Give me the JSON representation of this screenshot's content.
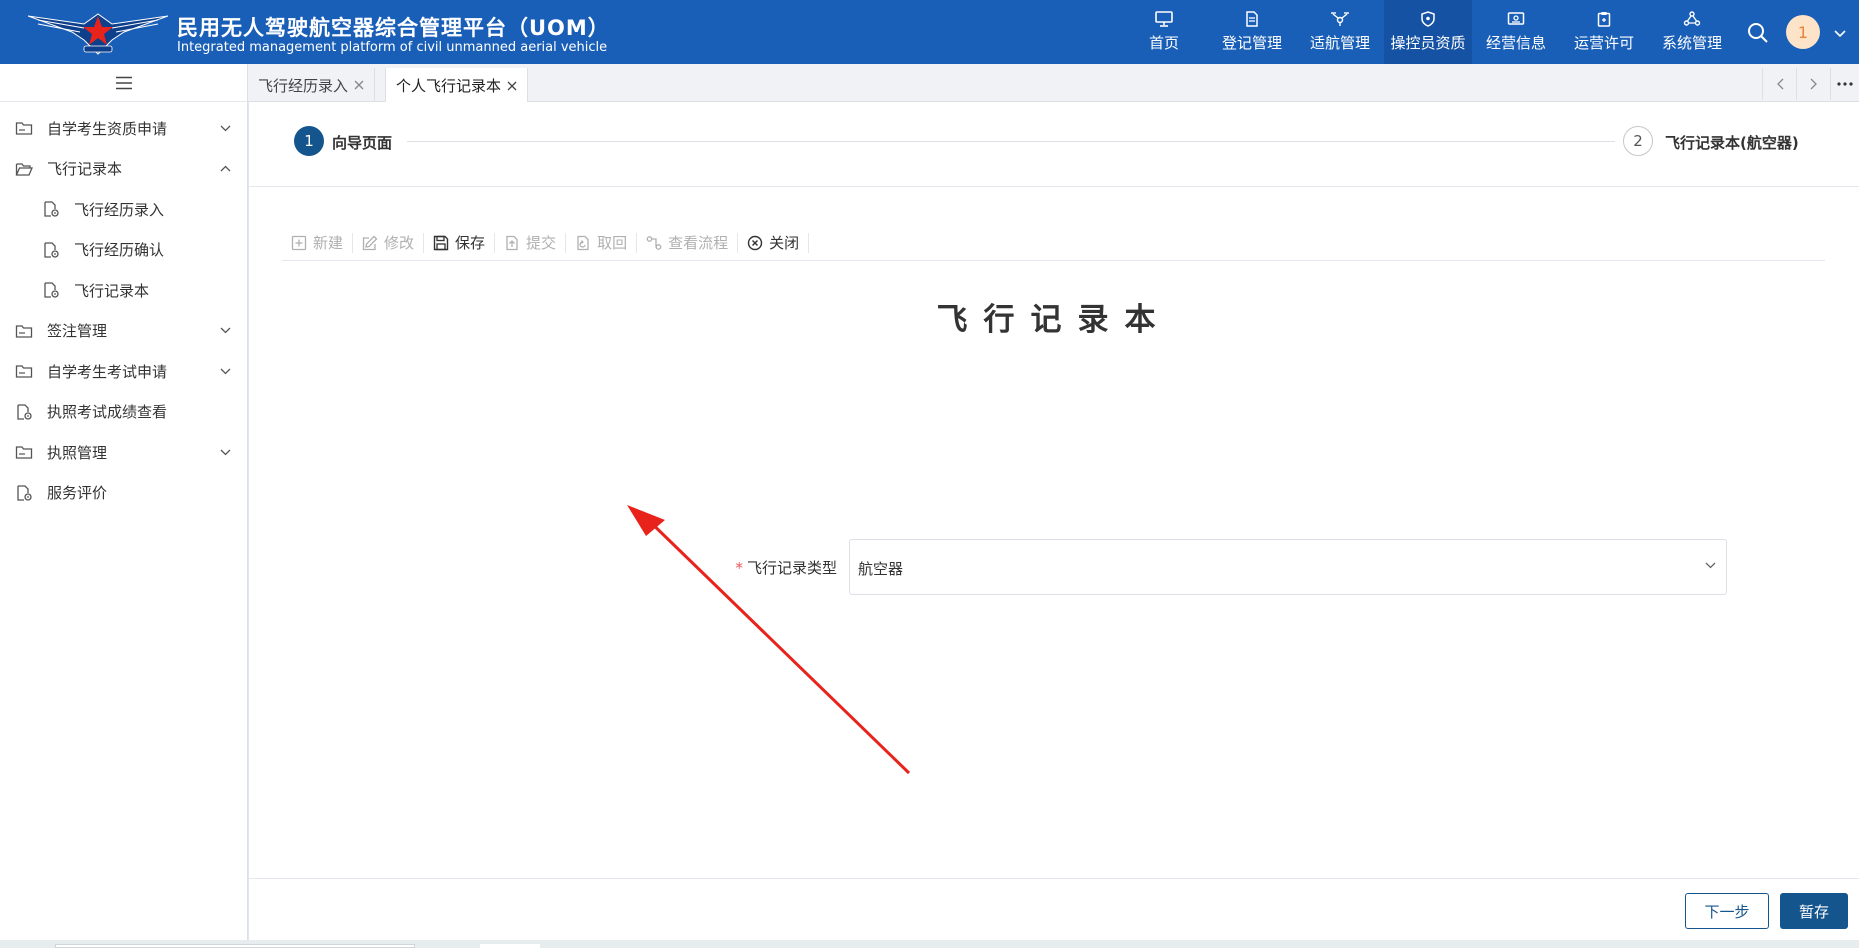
{
  "header": {
    "title": "民用无人驾驶航空器综合管理平台（UOM）",
    "subtitle": "Integrated management platform of civil unmanned aerial vehicle",
    "nav": [
      {
        "label": "首页",
        "icon": "monitor-icon",
        "active": false
      },
      {
        "label": "登记管理",
        "icon": "document-icon",
        "active": false
      },
      {
        "label": "适航管理",
        "icon": "drone-icon",
        "active": false
      },
      {
        "label": "操控员资质",
        "icon": "shield-icon",
        "active": true
      },
      {
        "label": "经营信息",
        "icon": "card-icon",
        "active": false
      },
      {
        "label": "运营许可",
        "icon": "clipboard-icon",
        "active": false
      },
      {
        "label": "系统管理",
        "icon": "cube-icon",
        "active": false
      }
    ],
    "avatar_text": "1"
  },
  "sidebar": {
    "items": [
      {
        "label": "自学考生资质申请",
        "icon": "folder-icon",
        "chevron": "down"
      },
      {
        "label": "飞行记录本",
        "icon": "folder-open-icon",
        "chevron": "up"
      },
      {
        "label": "飞行经历录入",
        "icon": "file-gear-icon",
        "sub": true
      },
      {
        "label": "飞行经历确认",
        "icon": "file-gear-icon",
        "sub": true
      },
      {
        "label": "飞行记录本",
        "icon": "file-gear-icon",
        "sub": true
      },
      {
        "label": "签注管理",
        "icon": "folder-icon",
        "chevron": "down"
      },
      {
        "label": "自学考生考试申请",
        "icon": "folder-icon",
        "chevron": "down"
      },
      {
        "label": "执照考试成绩查看",
        "icon": "file-gear-icon"
      },
      {
        "label": "执照管理",
        "icon": "folder-icon",
        "chevron": "down"
      },
      {
        "label": "服务评价",
        "icon": "file-gear-icon"
      }
    ]
  },
  "tabs": [
    {
      "label": "飞行经历录入",
      "active": false
    },
    {
      "label": "个人飞行记录本",
      "active": true
    }
  ],
  "steps": [
    {
      "num": "1",
      "label": "向导页面",
      "active": true
    },
    {
      "num": "2",
      "label": "飞行记录本(航空器)",
      "active": false
    }
  ],
  "toolbar": {
    "new": "新建",
    "edit": "修改",
    "save": "保存",
    "submit": "提交",
    "retrieve": "取回",
    "view_flow": "查看流程",
    "close": "关闭"
  },
  "page_title": "飞行记录本",
  "form": {
    "required_mark": "*",
    "type_label": "飞行记录类型",
    "type_value": "航空器"
  },
  "footer": {
    "next_label": "下一步",
    "temp_save_label": "暂存"
  },
  "colors": {
    "header_bg": "#1a5fb7",
    "primary": "#15558e",
    "arrow": "#e8231c"
  }
}
